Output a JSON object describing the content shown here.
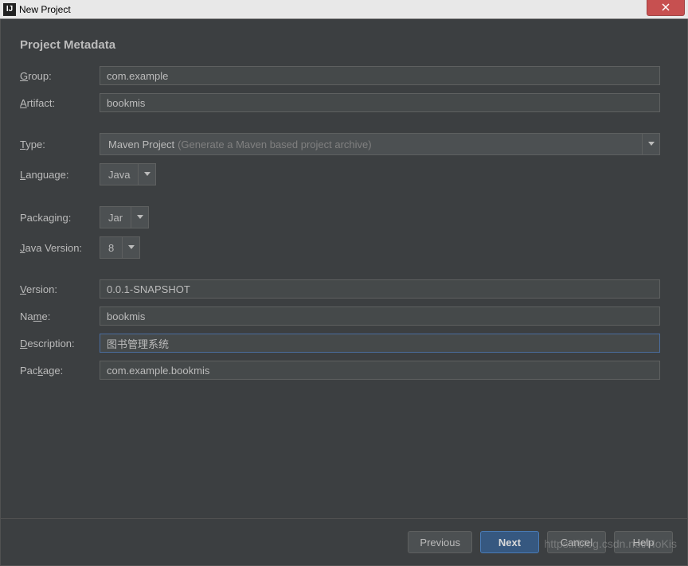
{
  "titlebar": {
    "icon_text": "IJ",
    "title": "New Project"
  },
  "section_title": "Project Metadata",
  "labels": {
    "group": "Group:",
    "artifact": "Artifact:",
    "type": "Type:",
    "language": "Language:",
    "packaging": "Packaging:",
    "java_version": "Java Version:",
    "version": "Version:",
    "name": "Name:",
    "description": "Description:",
    "package": "Package:"
  },
  "values": {
    "group": "com.example",
    "artifact": "bookmis",
    "type_primary": "Maven Project",
    "type_hint": "(Generate a Maven based project archive)",
    "language": "Java",
    "packaging": "Jar",
    "java_version": "8",
    "version": "0.0.1-SNAPSHOT",
    "name": "bookmis",
    "description": "图书管理系统",
    "package": "com.example.bookmis"
  },
  "buttons": {
    "previous": "Previous",
    "next": "Next",
    "cancel": "Cancel",
    "help": "Help"
  },
  "watermark": "https://blog.csdn.net/HoKis"
}
